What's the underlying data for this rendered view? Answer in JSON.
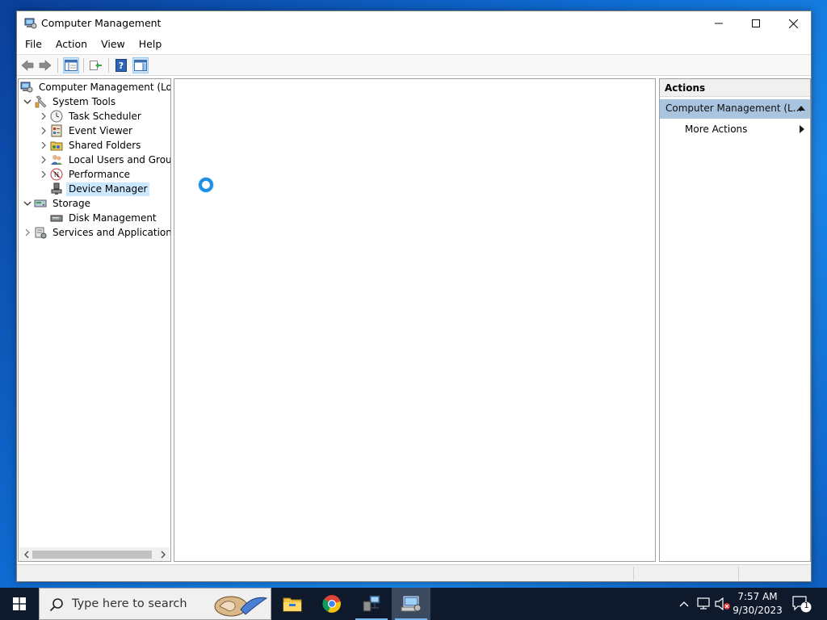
{
  "window": {
    "title": "Computer Management",
    "controls": {
      "minimize": "minimize",
      "maximize": "maximize",
      "close": "close"
    }
  },
  "menu": {
    "items": [
      "File",
      "Action",
      "View",
      "Help"
    ]
  },
  "toolbar": {
    "buttons": [
      "back-arrow-icon",
      "forward-arrow-icon",
      "show-hide-tree-icon",
      "export-list-icon",
      "help-icon",
      "show-hide-action-pane-icon"
    ]
  },
  "tree": {
    "root": "Computer Management (Local",
    "system_tools": "System Tools",
    "task_scheduler": "Task Scheduler",
    "event_viewer": "Event Viewer",
    "shared_folders": "Shared Folders",
    "local_users": "Local Users and Groups",
    "performance": "Performance",
    "device_manager": "Device Manager",
    "storage": "Storage",
    "disk_management": "Disk Management",
    "services": "Services and Applications"
  },
  "actions": {
    "header": "Actions",
    "section": "Computer Management (L...",
    "more_actions": "More Actions"
  },
  "taskbar": {
    "search_placeholder": "Type here to search",
    "apps": [
      "file-explorer-icon",
      "chrome-icon",
      "network-app-icon",
      "computer-management-icon"
    ],
    "clock_time": "7:57 AM",
    "clock_date": "9/30/2023",
    "notification_count": "1"
  },
  "colors": {
    "accent": "#1e8fe6",
    "selection": "#cce8ff",
    "actions_section": "#a8c4df",
    "taskbar": "#0e1a2b"
  }
}
